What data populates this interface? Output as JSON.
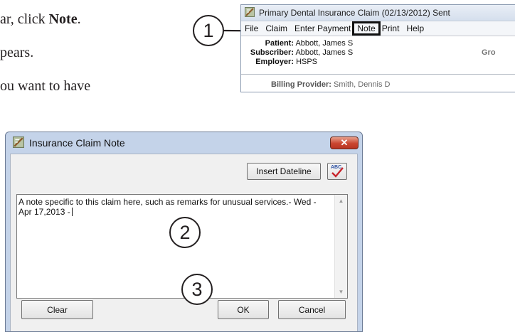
{
  "doc": {
    "line1_pre": "ar, click ",
    "line1_bold": "Note",
    "line1_post": ".",
    "line2": "pears.",
    "line3": "ou want to have"
  },
  "callouts": [
    "1",
    "2",
    "3"
  ],
  "claim_window": {
    "title": "Primary Dental Insurance Claim (02/13/2012) Sent",
    "menu": [
      "File",
      "Claim",
      "Enter Payment",
      "Note",
      "Print",
      "Help"
    ],
    "patient_label": "Patient:",
    "patient_value": "Abbott, James S",
    "subscriber_label": "Subscriber:",
    "subscriber_value": "Abbott, James S",
    "employer_label": "Employer:",
    "employer_value": "HSPS",
    "gro_text": "Gro",
    "billing_label": "Billing Provider:",
    "billing_value": "Smith, Dennis D"
  },
  "dialog": {
    "title": "Insurance Claim Note",
    "close_glyph": "✕",
    "insert_dateline": "Insert Dateline",
    "spell_icon_text": "ABC",
    "note_text": "A note specific to this claim here, such as remarks for unusual services.- Wed - Apr 17,2013 -",
    "clear_label": "Clear",
    "ok_label": "OK",
    "cancel_label": "Cancel"
  },
  "icons": {
    "app": "app-icon",
    "close": "close-icon",
    "spell": "spellcheck-icon",
    "scroll_up": "scroll-up-arrow-icon",
    "scroll_down": "scroll-down-arrow-icon"
  },
  "colors": {
    "dialog_frame": "#c4d3e9",
    "close_button": "#c9452f",
    "callout_border": "#231f20"
  }
}
